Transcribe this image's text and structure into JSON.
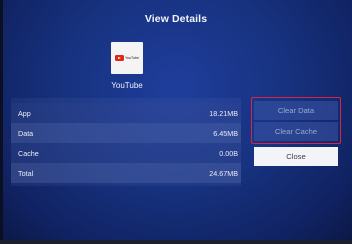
{
  "dialog": {
    "title": "View Details"
  },
  "app": {
    "icon": "youtube-logo",
    "icon_text": "YouTube",
    "name": "YouTube"
  },
  "storage": {
    "rows": [
      {
        "label": "App",
        "value": "18.21MB"
      },
      {
        "label": "Data",
        "value": "6.45MB"
      },
      {
        "label": "Cache",
        "value": "0.00B"
      },
      {
        "label": "Total",
        "value": "24.67MB"
      }
    ]
  },
  "actions": {
    "clear_data": "Clear Data",
    "clear_cache": "Clear Cache",
    "close": "Close"
  },
  "colors": {
    "background": "#17327f",
    "highlight_border": "#d62547",
    "youtube_red": "#e1251b"
  }
}
